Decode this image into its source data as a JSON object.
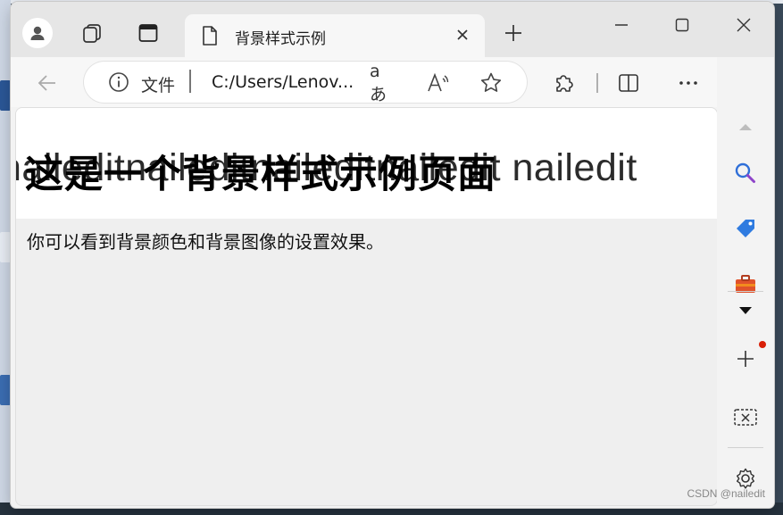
{
  "window": {
    "tab_title": "背景样式示例",
    "controls": [
      "minimize-icon",
      "maximize-icon",
      "close-icon"
    ]
  },
  "toolbar": {
    "address_scheme": "文件",
    "address_url": "C:/Users/Lenov...",
    "read_aloud_label": "aあ"
  },
  "page": {
    "watermark": "naileditnaileditnaileditnailedit  nailedit",
    "heading": "这是一个背景样式示例页面",
    "paragraph": "你可以看到背景颜色和背景图像的设置效果。"
  },
  "sidebar": {
    "items": [
      "scroll-up-icon",
      "search-icon",
      "tag-icon",
      "toolbox-icon",
      "expand-icon",
      "add-icon",
      "screenshot-icon",
      "settings-icon"
    ]
  },
  "overlay": {
    "csdn_watermark": "CSDN @nailedit"
  },
  "colors": {
    "accent_edge_blue": "#1f6fd1",
    "notification_dot": "#d81e06"
  }
}
